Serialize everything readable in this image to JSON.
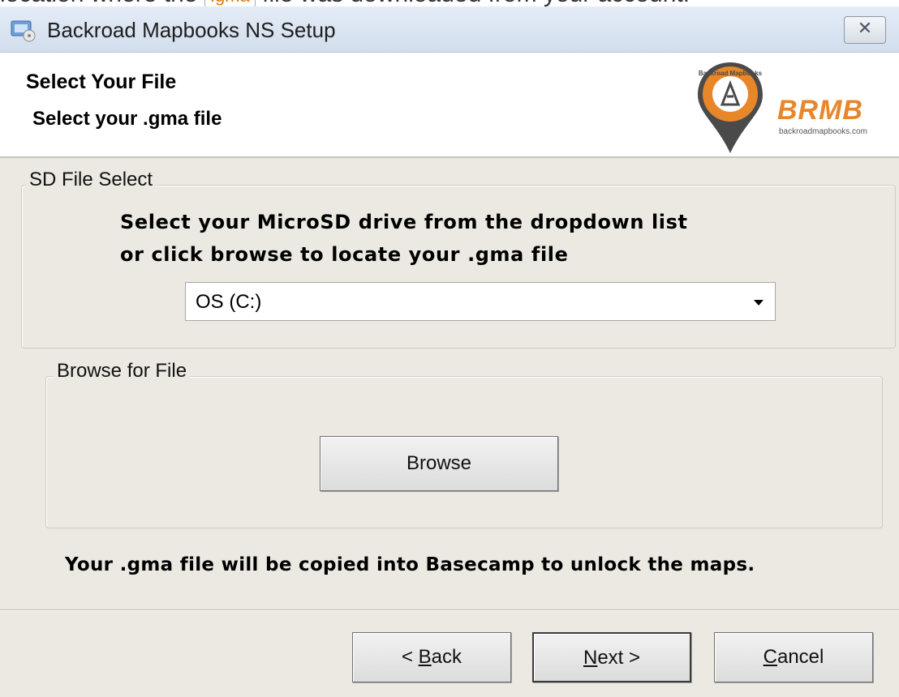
{
  "caption": {
    "prefix": "location where the",
    "chip": ".gma",
    "suffix": "file was downloaded from your account."
  },
  "window": {
    "title": "Backroad Mapbooks NS Setup",
    "close_glyph": "✕"
  },
  "header": {
    "title": "Select Your File",
    "subtitle": "Select your .gma file",
    "logo": {
      "badge_text": "Backroad Mapbooks",
      "brand": "BRMB",
      "url": "backroadmapbooks.com"
    }
  },
  "sd_group": {
    "label": "SD File Select",
    "instruction_line1": "Select your MicroSD drive from the dropdown list",
    "instruction_line2": "or click browse to locate your .gma file",
    "drive_select_value": "OS (C:)"
  },
  "browse_group": {
    "label": "Browse for File",
    "browse_button": "Browse"
  },
  "note": "Your .gma file will be copied into Basecamp to unlock the maps.",
  "footer": {
    "back": {
      "prefix": "< ",
      "mnemonic": "B",
      "rest": "ack"
    },
    "next": {
      "mnemonic": "N",
      "rest": "ext >"
    },
    "cancel": {
      "mnemonic": "C",
      "rest": "ancel"
    }
  },
  "colors": {
    "window_bg": "#ebe9e2",
    "titlebar": "#d8e3f0",
    "brand_orange": "#e8862a",
    "pin_gray": "#4a4a4a"
  }
}
